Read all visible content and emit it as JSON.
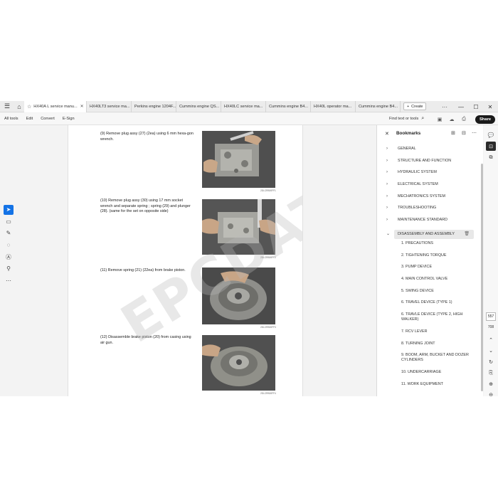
{
  "tabs": [
    {
      "label": "HX40A L service manu...",
      "active": true
    },
    {
      "label": "HX40LT3 service ma..."
    },
    {
      "label": "Perkins engine 1204F..."
    },
    {
      "label": "Cummins engine QS..."
    },
    {
      "label": "HX40LC service ma..."
    },
    {
      "label": "Cummins engine B4..."
    },
    {
      "label": "HX40L operator ma..."
    },
    {
      "label": "Cummins engine B4..."
    }
  ],
  "create_label": "Create",
  "more_label": "···",
  "menu": {
    "all_tools": "All tools",
    "edit": "Edit",
    "convert": "Convert",
    "esign": "E-Sign",
    "find": "Find text or tools",
    "share": "Share"
  },
  "document": {
    "steps": [
      {
        "text": "(9) Remove plug assy (27) (2ea) using 6 mm hexa-gon wrench.",
        "caption": "2DLCRB00FF1"
      },
      {
        "text": "(10) Remove plug assy (30) using 17 mm socket wrench and separate spring ; spring (29) and plunger (28). (same for the set on opposite side)",
        "caption": "2DLCRB00FF2"
      },
      {
        "text": "(11) Remove spring (21) (22ea) from brake piston.",
        "caption": "2DLCRB00FF3"
      },
      {
        "text": "(12) Disassemble brake piston (20) from casing using air gun.",
        "caption": "2DLCRB00FF4"
      }
    ],
    "watermark": "EPCDATO.COM"
  },
  "bookmarks": {
    "title": "Bookmarks",
    "top_items": [
      "GENERAL",
      "STRUCTURE AND FUNCTION",
      "HYDRAULIC SYSTEM",
      "ELECTRICAL SYSTEM",
      "MECHATRONICS SYSTEM",
      "TROUBLESHOOTING",
      "MAINTENANCE STANDARD"
    ],
    "selected": "DISASSEMBLY AND ASSEMBLY",
    "children": [
      "1. PRECAUTIONS",
      "2. TIGHTENING TORQUE",
      "3. PUMP DEVICE",
      "4. MAIN CONTROL VALVE",
      "5. SWING DEVICE",
      "6. TRAVEL DEVICE (TYPE 1)",
      "6. TRAVLE DEVICE (TYPE 2, HIGH WALKER)",
      "7. RCV LEVER",
      "8. TURNING JOINT",
      "9. BOOM, ARM, BUCKET AND DOZER CYLINDERS",
      "10. UNDERCARRIAGE",
      "11. WORK EQUIPMENT"
    ]
  },
  "page_nav": {
    "current": "557",
    "total": "708"
  }
}
